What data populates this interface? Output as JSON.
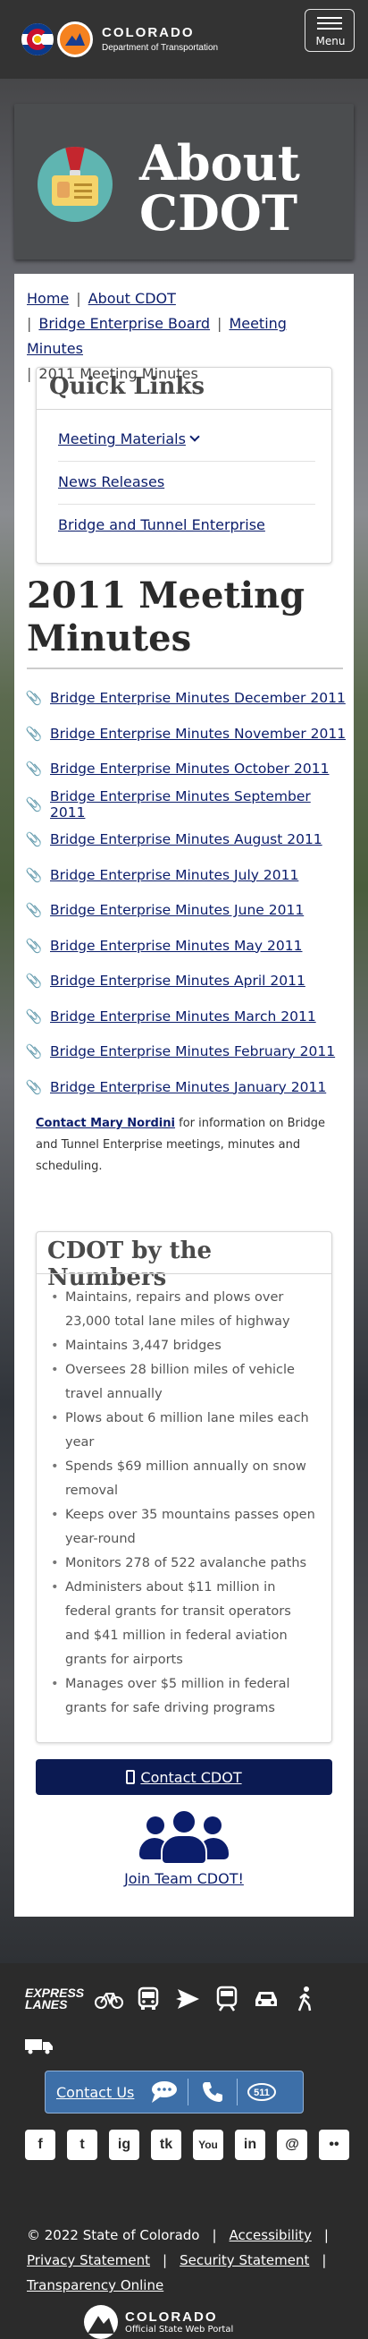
{
  "header": {
    "brand_line1": "COLORADO",
    "brand_line2": "Department of Transportation",
    "menu_label": "Menu"
  },
  "hero": {
    "title_line1": "About",
    "title_line2": "CDOT"
  },
  "breadcrumb": {
    "home": "Home",
    "about": "About CDOT",
    "board": "Bridge Enterprise Board",
    "minutes": "Meeting Minutes",
    "current": "2011 Meeting Minutes",
    "separator": "|"
  },
  "quick_links": {
    "title": "Quick Links",
    "items": [
      "Meeting Materials",
      "News Releases",
      "Bridge and Tunnel Enterprise"
    ]
  },
  "page_title": "2011 Meeting Minutes",
  "minutes": [
    "Bridge Enterprise Minutes December 2011",
    "Bridge Enterprise Minutes November 2011",
    "Bridge Enterprise Minutes October 2011",
    "Bridge Enterprise Minutes September 2011",
    "Bridge Enterprise Minutes August 2011",
    "Bridge Enterprise Minutes July 2011",
    "Bridge Enterprise Minutes June 2011",
    "Bridge Enterprise Minutes May 2011",
    "Bridge Enterprise Minutes April 2011",
    "Bridge Enterprise Minutes March 2011",
    "Bridge Enterprise Minutes February 2011",
    "Bridge Enterprise Minutes January 2011"
  ],
  "contact_note": {
    "link": "Contact Mary Nordini",
    "text": " for information on Bridge and Tunnel Enterprise meetings, minutes and scheduling."
  },
  "numbers": {
    "title": "CDOT by the Numbers",
    "items": [
      "Maintains, repairs and plows over 23,000 total lane miles of highway",
      "Maintains 3,447 bridges",
      "Oversees 28 billion miles of vehicle travel annually",
      "Plows about 6 million lane miles each year",
      "Spends $69 million annually on snow removal",
      "Keeps over 35 mountains passes open year-round",
      "Monitors 278 of 522 avalanche paths",
      "Administers about $11 million in federal grants for transit operators and $41 million in federal aviation grants for airports",
      "Manages over $5 million in federal grants for safe driving programs"
    ]
  },
  "contact_button": "Contact CDOT",
  "join_team": "Join Team CDOT!",
  "footer": {
    "express_lanes": [
      "EXPRESS",
      "LANES"
    ],
    "contact_us": "Contact Us",
    "social": [
      "f",
      "t",
      "ig",
      "tk",
      "You",
      "in",
      "@",
      "••"
    ],
    "copyright": "© 2022 State of Colorado",
    "accessibility": "Accessibility",
    "privacy": "Privacy Statement",
    "security": "Security Statement",
    "transparency": "Transparency Online",
    "portal_line1": "COLORADO",
    "portal_line2": "Official State Web Portal"
  },
  "colors": {
    "link": "#0b1d6b",
    "header_bg": "#333333",
    "button_bg": "#0b1a52",
    "contact_bar": "#3d6fa8"
  }
}
